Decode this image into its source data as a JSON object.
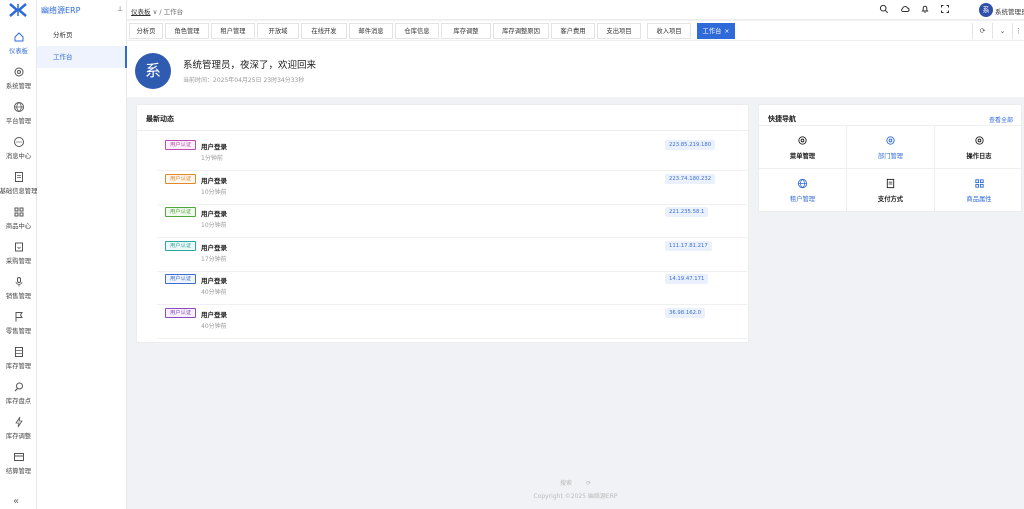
{
  "app": {
    "brand": "幽络源ERP",
    "pin_icon": "pin-icon"
  },
  "rail": [
    {
      "label": "仪表板",
      "icon": "home-icon"
    },
    {
      "label": "系统管理",
      "icon": "gear-icon"
    },
    {
      "label": "平台管理",
      "icon": "globe-icon"
    },
    {
      "label": "消息中心",
      "icon": "chat-icon"
    },
    {
      "label": "基础信息管理",
      "icon": "doc-icon"
    },
    {
      "label": "商品中心",
      "icon": "grid-icon"
    },
    {
      "label": "采购管理",
      "icon": "cart-icon"
    },
    {
      "label": "销售管理",
      "icon": "mic-icon"
    },
    {
      "label": "零售管理",
      "icon": "flag-icon"
    },
    {
      "label": "库存管理",
      "icon": "box-icon"
    },
    {
      "label": "库存盘点",
      "icon": "magnifier-icon"
    },
    {
      "label": "库存调整",
      "icon": "bolt-icon"
    },
    {
      "label": "结算管理",
      "icon": "card-icon"
    }
  ],
  "side": {
    "items": [
      "分析页",
      "工作台"
    ]
  },
  "header": {
    "breadcrumb_first": "仪表板",
    "breadcrumb_sep": "∨ /",
    "breadcrumb_current": "工作台",
    "user_avatar": "系",
    "user_name": "系统管理员"
  },
  "tabs": [
    "分析页",
    "角色管理",
    "租户管理",
    "开放域",
    "在线开发",
    "邮件消息",
    "仓库信息",
    "库存调整",
    "库存调整原因",
    "客户费用",
    "支出项目",
    "收入项目",
    "工作台"
  ],
  "tab_close": "×",
  "welcome": {
    "avatar": "系",
    "title": "系统管理员，夜深了，欢迎回来",
    "time": "当前时间：2025年04月25日 23时34分33秒"
  },
  "activity": {
    "title": "最新动态",
    "rows": [
      {
        "tag": "用户认证",
        "name": "用户登录",
        "ago": "1分钟前",
        "ip": "223.85.219.180",
        "color": "#c04bb5"
      },
      {
        "tag": "用户认证",
        "name": "用户登录",
        "ago": "10分钟前",
        "ip": "223.74.180.232",
        "color": "#e08a2b"
      },
      {
        "tag": "用户认证",
        "name": "用户登录",
        "ago": "10分钟前",
        "ip": "221.235.58.1",
        "color": "#52a83a"
      },
      {
        "tag": "用户认证",
        "name": "用户登录",
        "ago": "17分钟前",
        "ip": "111.17.81.217",
        "color": "#2aa7a0"
      },
      {
        "tag": "用户认证",
        "name": "用户登录",
        "ago": "40分钟前",
        "ip": "14.19.47.171",
        "color": "#3c6fd0"
      },
      {
        "tag": "用户认证",
        "name": "用户登录",
        "ago": "40分钟前",
        "ip": "36.98.162.0",
        "color": "#8a4bc0"
      }
    ]
  },
  "quicknav": {
    "title": "快捷导航",
    "view_all": "查看全部",
    "items": [
      {
        "label": "菜单管理",
        "icon": "gear-icon"
      },
      {
        "label": "部门管理",
        "icon": "gear-icon"
      },
      {
        "label": "操作日志",
        "icon": "gear-icon"
      },
      {
        "label": "租户管理",
        "icon": "globe-icon"
      },
      {
        "label": "支付方式",
        "icon": "doc-icon"
      },
      {
        "label": "商品属性",
        "icon": "grid-icon"
      }
    ]
  },
  "footer": {
    "line1": "搜索　　 ⟳",
    "line2": "Copyright ©2025 幽络源ERP"
  },
  "colors": {
    "accent": "#2f6bd8",
    "avatar": "#2f5bb0"
  }
}
